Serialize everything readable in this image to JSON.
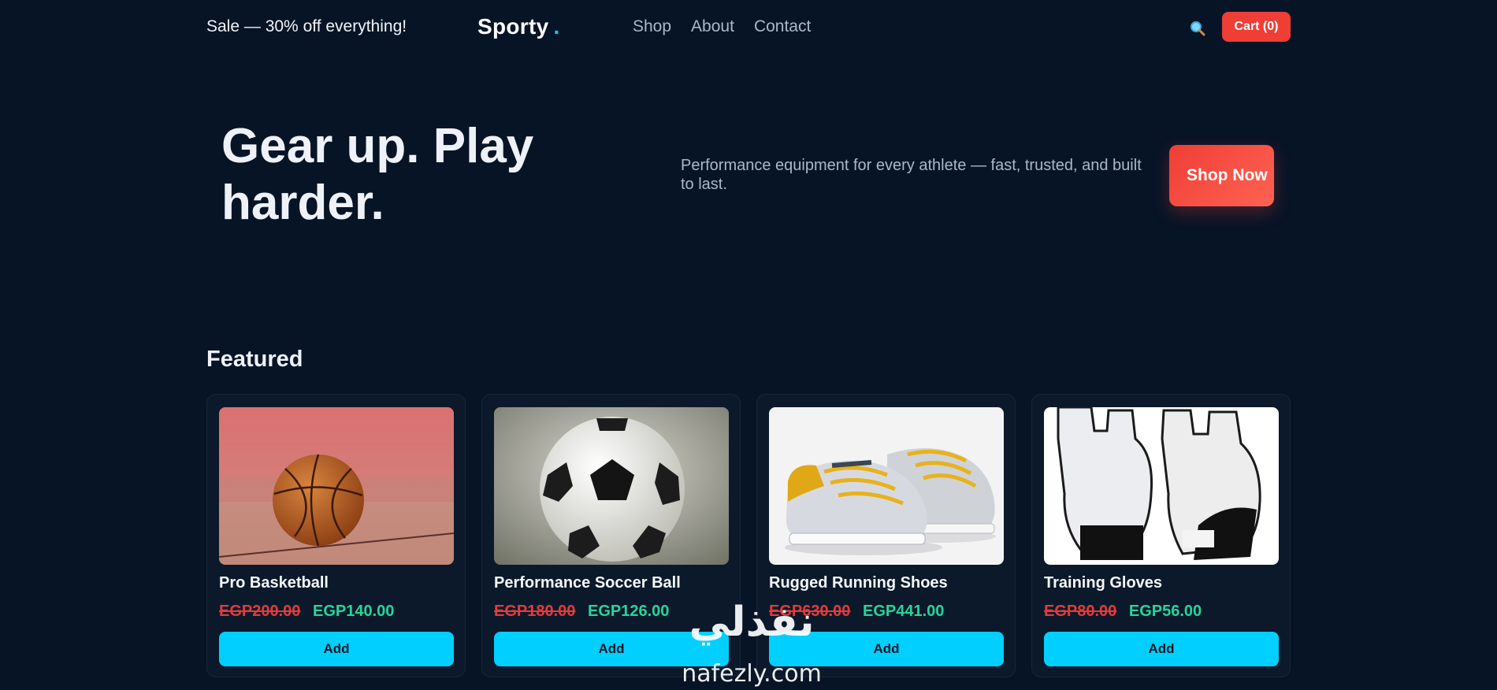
{
  "header": {
    "promo": "Sale — 30% off everything!",
    "brand": "Sporty",
    "brand_dot": ".",
    "nav": [
      "Shop",
      "About",
      "Contact"
    ],
    "search_icon": "search-icon",
    "cart_label": "Cart (0)"
  },
  "hero": {
    "title": "Gear up. Play harder.",
    "subtitle": "Performance equipment for every athlete — fast, trusted, and built to last.",
    "cta": "Shop Now"
  },
  "featured": {
    "title": "Featured",
    "products": [
      {
        "name": "Pro Basketball",
        "old_price": "EGP200.00",
        "new_price": "EGP140.00",
        "add_label": "Add",
        "image": "basketball-image"
      },
      {
        "name": "Performance Soccer Ball",
        "old_price": "EGP180.00",
        "new_price": "EGP126.00",
        "add_label": "Add",
        "image": "soccer-ball-image"
      },
      {
        "name": "Rugged Running Shoes",
        "old_price": "EGP630.00",
        "new_price": "EGP441.00",
        "add_label": "Add",
        "image": "running-shoes-image"
      },
      {
        "name": "Training Gloves",
        "old_price": "EGP80.00",
        "new_price": "EGP56.00",
        "add_label": "Add",
        "image": "training-gloves-image"
      }
    ]
  },
  "watermark": {
    "arabic": "نفذلي",
    "latin": "nafezly.com"
  },
  "colors": {
    "background": "#071426",
    "accent": "#00cfff",
    "cart": "#ef3e36",
    "sale_price": "#28d49a",
    "old_price": "#e23b3b"
  }
}
